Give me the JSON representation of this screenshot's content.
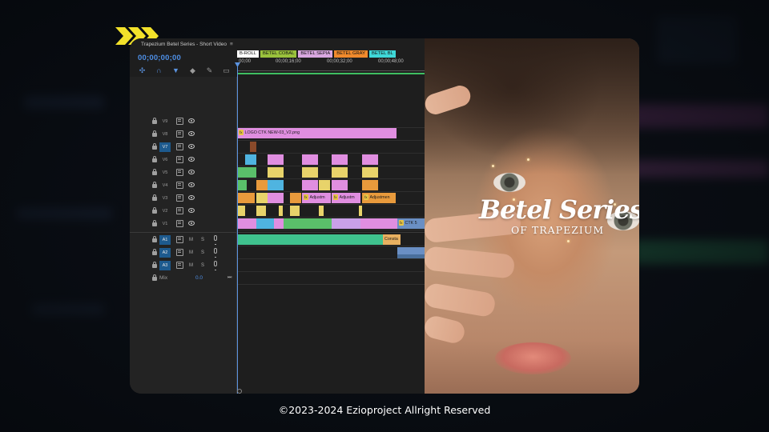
{
  "window": {
    "title": "Trapezium Betel Series - Short Video",
    "menu_icon": "hamburger-icon"
  },
  "timecode": "00;00;00;00",
  "tools": [
    "snap-icon",
    "magnet-icon",
    "marker-icon",
    "marker-add-icon",
    "wrench-icon",
    "captions-icon"
  ],
  "label_tabs": [
    {
      "text": "B-ROLL",
      "color": "#ffffff"
    },
    {
      "text": "BETEL COBAL",
      "color": "#9ac23c"
    },
    {
      "text": "BETEL SEPIA",
      "color": "#d9a7e0"
    },
    {
      "text": "BETEL GRAY",
      "color": "#f08a2c"
    },
    {
      "text": "BETEL BL",
      "color": "#3fd8d8"
    }
  ],
  "ruler_times": [
    "00;00",
    "00;00;16;00",
    "00;00;32;00",
    "00;00;48;00"
  ],
  "video_tracks": [
    {
      "name": "V9",
      "active": false
    },
    {
      "name": "V8",
      "active": false
    },
    {
      "name": "V7",
      "active": true
    },
    {
      "name": "V6",
      "active": false
    },
    {
      "name": "V5",
      "active": false
    },
    {
      "name": "V4",
      "active": false
    },
    {
      "name": "V3",
      "active": false
    },
    {
      "name": "V2",
      "active": false
    },
    {
      "name": "V1",
      "active": false
    }
  ],
  "audio_tracks": [
    {
      "name": "A1",
      "m": "M",
      "s": "S"
    },
    {
      "name": "A2",
      "m": "M",
      "s": "S"
    },
    {
      "name": "A3",
      "m": "M",
      "s": "S"
    }
  ],
  "mix": {
    "label": "Mix",
    "value": "0.0"
  },
  "clips": {
    "logo": "LOGO CTK NEW-03_V2.png",
    "adjust1": "Adjustm",
    "adjust2": "Adjustm",
    "adjust3": "Adjustmen",
    "ctk": "CTK 5",
    "constant": "Consta"
  },
  "poster": {
    "title": "Betel Series",
    "subtitle": "OF TRAPEZIUM"
  },
  "footer": "©2023-2024 Ezioproject Allright Reserved",
  "colors": {
    "accent": "#4e8fe6",
    "timeline_green": "#3fbf62",
    "clip_pink": "#e08ee0",
    "clip_green": "#5ac06a",
    "clip_blue": "#4fb4e0",
    "clip_orange": "#e89a3c",
    "clip_yellow": "#e8d36a",
    "audio_green": "#3fc28e"
  }
}
